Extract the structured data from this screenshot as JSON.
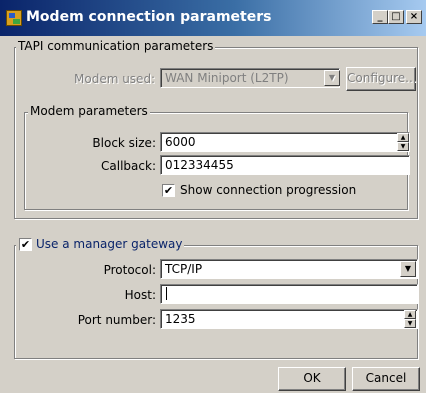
{
  "window": {
    "title": "Modem connection parameters",
    "minimize": "_",
    "maximize": "□",
    "close": "×"
  },
  "tapi": {
    "legend": "TAPI communication parameters",
    "modem_label": "Modem used:",
    "modem_value": "WAN Miniport (L2TP)",
    "configure_label": "Configure..."
  },
  "modem_params": {
    "legend": "Modem parameters",
    "block_size_label": "Block size:",
    "block_size_value": "6000",
    "callback_label": "Callback:",
    "callback_value": "012334455",
    "show_progression_label": "Show connection progression",
    "show_progression_checked": true
  },
  "gateway": {
    "legend": "Use a manager gateway",
    "enabled": true,
    "protocol_label": "Protocol:",
    "protocol_value": "TCP/IP",
    "host_label": "Host:",
    "host_value": "",
    "port_label": "Port number:",
    "port_value": "1235"
  },
  "buttons": {
    "ok": "OK",
    "cancel": "Cancel"
  },
  "glyphs": {
    "check": "✔",
    "dropdown": "▼",
    "spin_up": "▲",
    "spin_down": "▼"
  },
  "colors": {
    "titlebar_start": "#0a246a",
    "titlebar_end": "#a6caf0",
    "dialog_bg": "#d4d0c8",
    "legend_blue": "#0a246a"
  }
}
